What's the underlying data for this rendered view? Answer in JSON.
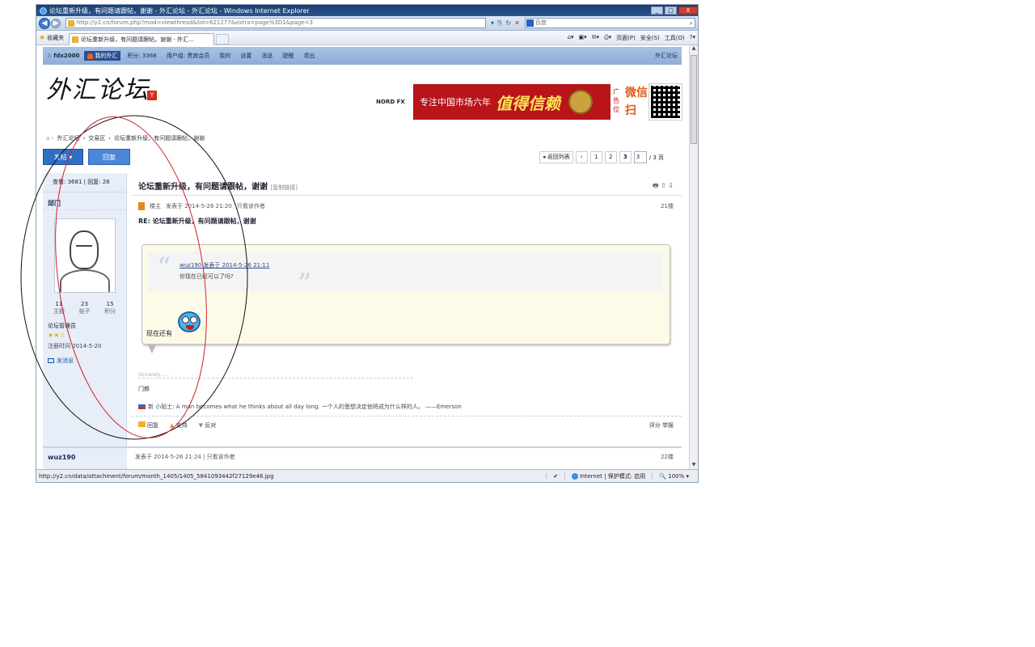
{
  "window": {
    "title": "论坛重新升级，有问题请跟帖，谢谢 - 外汇论坛 - 外汇论坛 - Windows Internet Explorer",
    "min": "_",
    "max": "□",
    "close": "X"
  },
  "address": {
    "url": "http://y2.cn/forum.php?mod=viewthread&tid=621277&extra=page%3D1&page=3",
    "search_placeholder": "百度"
  },
  "favorites": {
    "label": "收藏夹",
    "tab_title": "论坛重新升级，有问题请跟帖，谢谢 - 外汇...",
    "commands": [
      "页面(P)",
      "安全(S)",
      "工具(O)"
    ]
  },
  "topnav": {
    "user": "fdx2000",
    "badge": "我的外汇",
    "points": "积分: 3368",
    "items": [
      "用户组: 贵宾会员",
      "我的",
      "设置",
      "消息",
      "提醒",
      "退出"
    ],
    "right": "外汇论坛"
  },
  "logo": {
    "text": "外汇论坛",
    "badge": "Y"
  },
  "banner": {
    "brand": "NORD FX",
    "slogan": "专注中国市场六年",
    "highlight": "值得信赖",
    "vertical": "广告位",
    "weixin": "微信 扫"
  },
  "breadcrumb": [
    "外汇论坛",
    "交易区",
    "论坛重新升级，有问题请跟帖，谢谢"
  ],
  "buttons": {
    "post": "发帖 ▾",
    "reply": "回复"
  },
  "pager": {
    "prev": "◂ 返回列表",
    "pages": [
      "‹",
      "1",
      "2",
      "3"
    ],
    "current": "3",
    "total": "/ 3 页"
  },
  "sidebar": {
    "header": "查看: 3681 | 回复: 26",
    "username": "邱门",
    "stats": [
      {
        "value": "11",
        "label": "主题"
      },
      {
        "value": "23",
        "label": "帖子"
      },
      {
        "value": "15",
        "label": "积分"
      }
    ],
    "role": "论坛管理员",
    "stars": "★★☆",
    "online": "注册时间 2014-5-20",
    "message": "发消息"
  },
  "thread": {
    "title": "论坛重新升级，有问题请跟帖，谢谢",
    "title_sub": "[复制链接]",
    "icons": "🖶 ⇧ ⇩",
    "meta_author": "楼主",
    "meta_time": "发表于 2014-5-26 21:20",
    "meta_only": "只看该作者",
    "floor": "21楼"
  },
  "post": {
    "reply_title": "RE: 论坛重新升级，有问题请跟帖，谢谢",
    "quote_author": "wuz190 发表于 2014-5-26 21:11",
    "quote_text": "你现在已经可以了吗?",
    "body": "现在还有",
    "sig_line": "Sincerely......",
    "sig1": "门郎",
    "sig2": "新 小贴士: A man becomes what he thinks about all day long. 一个人的思想决定他将成为什么样的人。 ——Emerson"
  },
  "actions": {
    "reply": "回复",
    "support": "支持",
    "oppose": "反对",
    "right": "评分 举报"
  },
  "nextpost": {
    "user": "wuz190",
    "meta": "发表于 2014-5-26 21:24 | 只看该作者",
    "floor": "22楼"
  },
  "status": {
    "url": "http://y2.cn/data/attachment/forum/month_1405/1405_5841093442f27129e46.jpg",
    "zone": "Internet | 保护模式: 启用",
    "zoom": "100%"
  }
}
